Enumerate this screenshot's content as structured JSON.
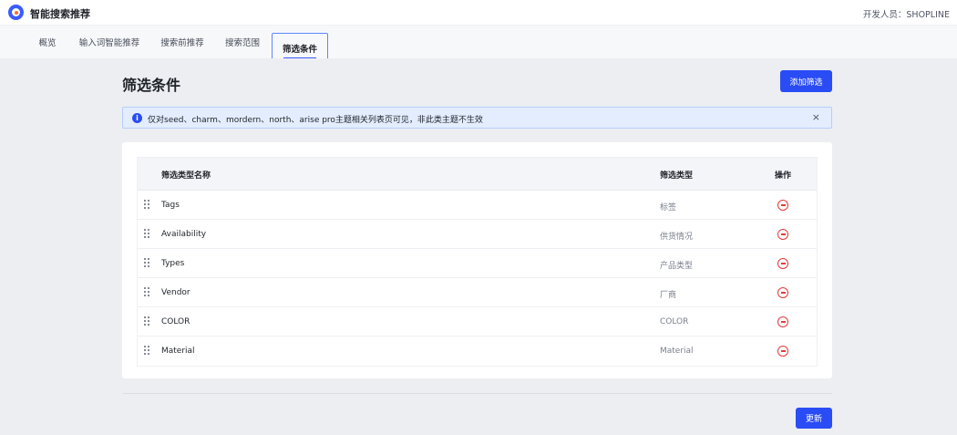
{
  "app": {
    "title": "智能搜索推荐",
    "developer": "开发人员：SHOPLINE",
    "logo_icon": "search-app-logo",
    "brand_color": "#2a4cf5"
  },
  "tabs": [
    {
      "label": "概览"
    },
    {
      "label": "输入词智能推荐"
    },
    {
      "label": "搜索前推荐"
    },
    {
      "label": "搜索范围"
    },
    {
      "label": "筛选条件",
      "active": true
    }
  ],
  "page": {
    "title": "筛选条件",
    "add_button": "添加筛选",
    "update_button": "更新"
  },
  "notice": {
    "icon": "info-icon",
    "text": "仅对seed、charm、mordern、north、arise pro主题相关列表页可见，非此类主题不生效",
    "close_icon": "close-icon"
  },
  "table": {
    "headers": {
      "name": "筛选类型名称",
      "type": "筛选类型",
      "action": "操作"
    },
    "rows": [
      {
        "name": "Tags",
        "type": "标签"
      },
      {
        "name": "Availability",
        "type": "供货情况"
      },
      {
        "name": "Types",
        "type": "产品类型"
      },
      {
        "name": "Vendor",
        "type": "厂商"
      },
      {
        "name": "COLOR",
        "type": "COLOR"
      },
      {
        "name": "Material",
        "type": "Material"
      }
    ],
    "row_icons": {
      "drag": "drag-handle-icon",
      "remove": "remove-circle-icon"
    },
    "remove_color": "#e53a3a"
  }
}
